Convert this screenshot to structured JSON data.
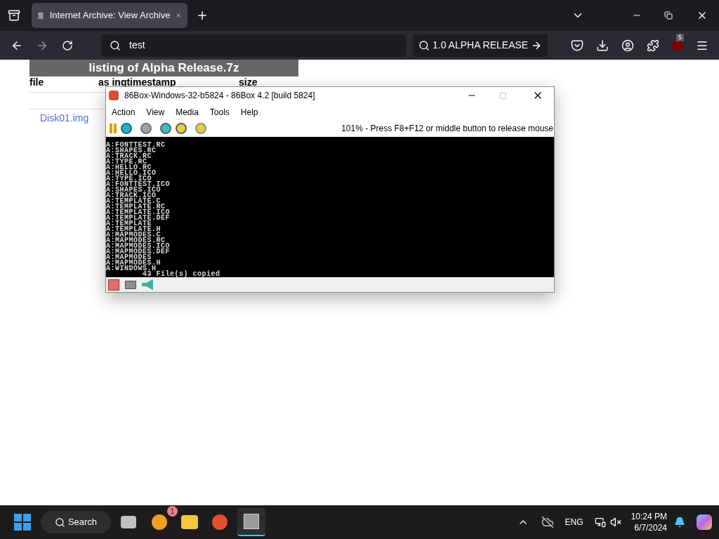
{
  "browser": {
    "tab": {
      "title": "Internet Archive: View Archive",
      "selected": true
    },
    "address": "test",
    "search_button": "1.0 ALPHA RELEASE",
    "extension_badge": "5"
  },
  "page": {
    "title": "listing of Alpha Release.7z",
    "columns": [
      "file",
      "as ingtimestamp",
      "size"
    ],
    "rows": [
      {
        "file": "Disk01.img"
      }
    ]
  },
  "emulator": {
    "title": "86Box-Windows-32-b5824 - 86Box 4.2 [build 5824]",
    "menu": [
      "Action",
      "View",
      "Media",
      "Tools",
      "Help"
    ],
    "status": "101% - Press F8+F12 or middle button to release mouse",
    "screen_lines": [
      "A:FONTTEST.RC",
      "A:SHAPES.RC",
      "A:TRACK.RC",
      "A:TYPE.RC",
      "A:HELLO.RC",
      "A:HELLO.ICO",
      "A:TYPE.ICO",
      "A:FONTTEST.ICO",
      "A:SHAPES.ICO",
      "A:TRACK.ICO",
      "A:TEMPLATE.C",
      "A:TEMPLATE.RC",
      "A:TEMPLATE.ICO",
      "A:TEMPLATE.DEF",
      "A:TEMPLATE",
      "A:TEMPLATE.H",
      "A:MAPMODES.C",
      "A:MAPMODES.RC",
      "A:MAPMODES.ICO",
      "A:MAPMODES.DEF",
      "A:MAPMODES",
      "A:MAPMODES.H",
      "A:WINDOWS.H",
      "        43 File(s) copied"
    ]
  },
  "taskbar": {
    "search": "Search",
    "app_badge": "1",
    "language": "ENG",
    "time": "10:24 PM",
    "date": "6/7/2024"
  }
}
